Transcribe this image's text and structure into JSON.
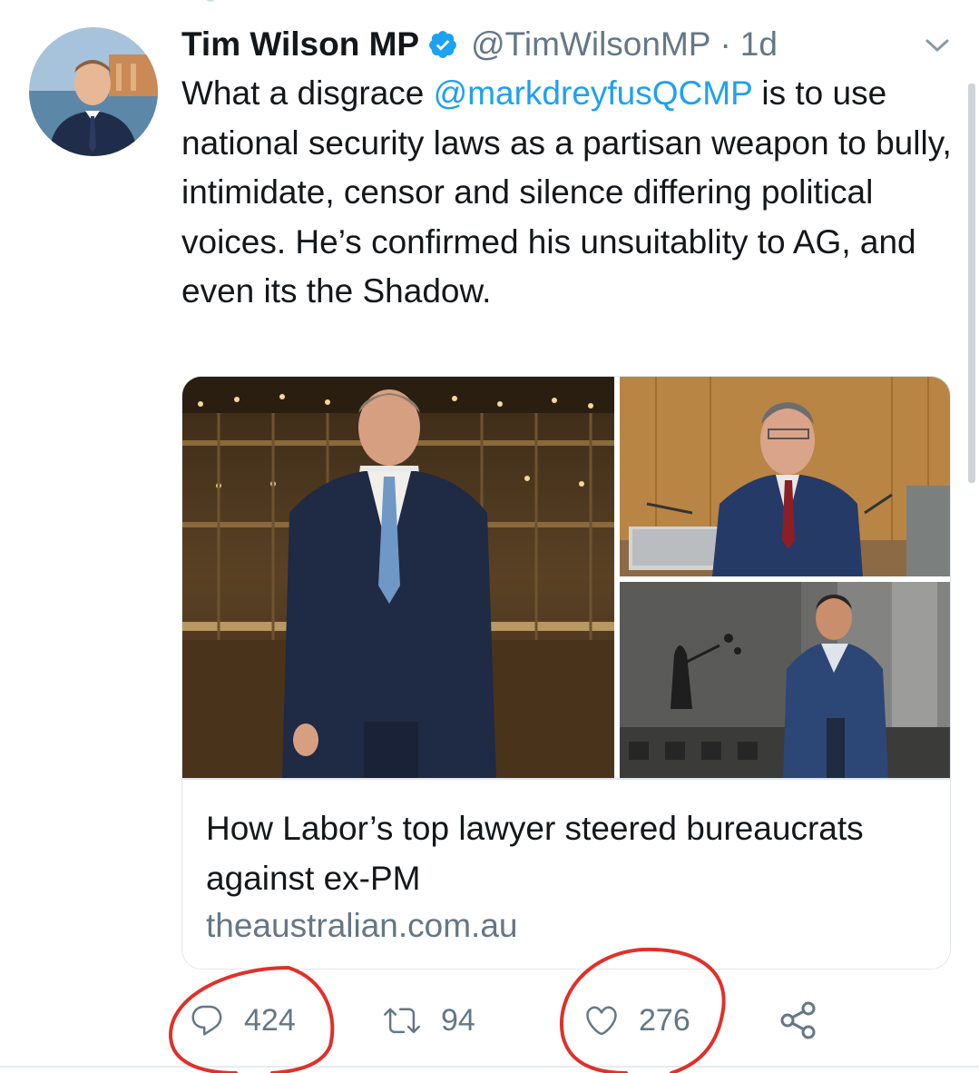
{
  "tweet": {
    "author_name": "Tim Wilson MP",
    "handle": "@TimWilsonMP",
    "separator": "·",
    "time": "1d",
    "text_before_mention": "What a disgrace ",
    "mention": "@markdreyfusQCMP",
    "text_after_mention": " is to use national security laws as a partisan weapon to bully, intimidate, censor and silence differing political voices. He’s confirmed his unsuitablity to AG, and even its the Shadow."
  },
  "card": {
    "title": "How Labor’s top lawyer steered bureaucrats against ex-PM",
    "domain": "theaustralian.com.au"
  },
  "actions": {
    "reply_count": "424",
    "retweet_count": "94",
    "like_count": "276"
  },
  "icons": {
    "verified": "verified-badge-icon",
    "caret": "chevron-down-icon",
    "reply": "reply-icon",
    "retweet": "retweet-icon",
    "like": "heart-icon",
    "share": "share-icon"
  },
  "colors": {
    "link": "#1da1f2",
    "secondary_text": "#657786",
    "annotation_circle": "#e0302a"
  }
}
